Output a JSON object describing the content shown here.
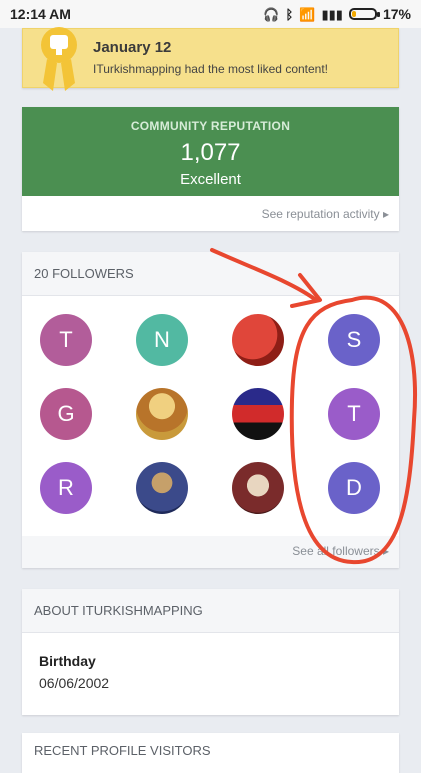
{
  "status_bar": {
    "time": "12:14 AM",
    "battery": "17%",
    "battery_level": 0.17
  },
  "award": {
    "date": "January 12",
    "text": "ITurkishmapping had the most liked content!"
  },
  "reputation": {
    "label": "COMMUNITY REPUTATION",
    "value": "1,077",
    "word": "Excellent",
    "link": "See reputation activity ▸"
  },
  "followers": {
    "title": "20 FOLLOWERS",
    "link": "See all followers ▸",
    "avatars": [
      {
        "letter": "T",
        "color": "#b25d9a"
      },
      {
        "letter": "N",
        "color": "#52b9a2"
      },
      {
        "letter": "",
        "color": "#c0392b",
        "icon": "red-ball-avatar"
      },
      {
        "letter": "S",
        "color": "#6a62c9"
      },
      {
        "letter": "G",
        "color": "#b6588f"
      },
      {
        "letter": "",
        "color": "#c99a3b",
        "icon": "icon-avatar"
      },
      {
        "letter": "",
        "color": "#5b2a6b",
        "icon": "flag-avatar"
      },
      {
        "letter": "T",
        "color": "#9a5cc9"
      },
      {
        "letter": "R",
        "color": "#9a5cc9"
      },
      {
        "letter": "",
        "color": "#3b4a8a",
        "icon": "art-avatar"
      },
      {
        "letter": "",
        "color": "#7a2b2b",
        "icon": "portrait-avatar"
      },
      {
        "letter": "D",
        "color": "#6a62c9"
      }
    ]
  },
  "about": {
    "title": "ABOUT ITURKISHMAPPING",
    "birthday_label": "Birthday",
    "birthday_value": "06/06/2002"
  },
  "visitors": {
    "title": "RECENT PROFILE VISITORS"
  }
}
